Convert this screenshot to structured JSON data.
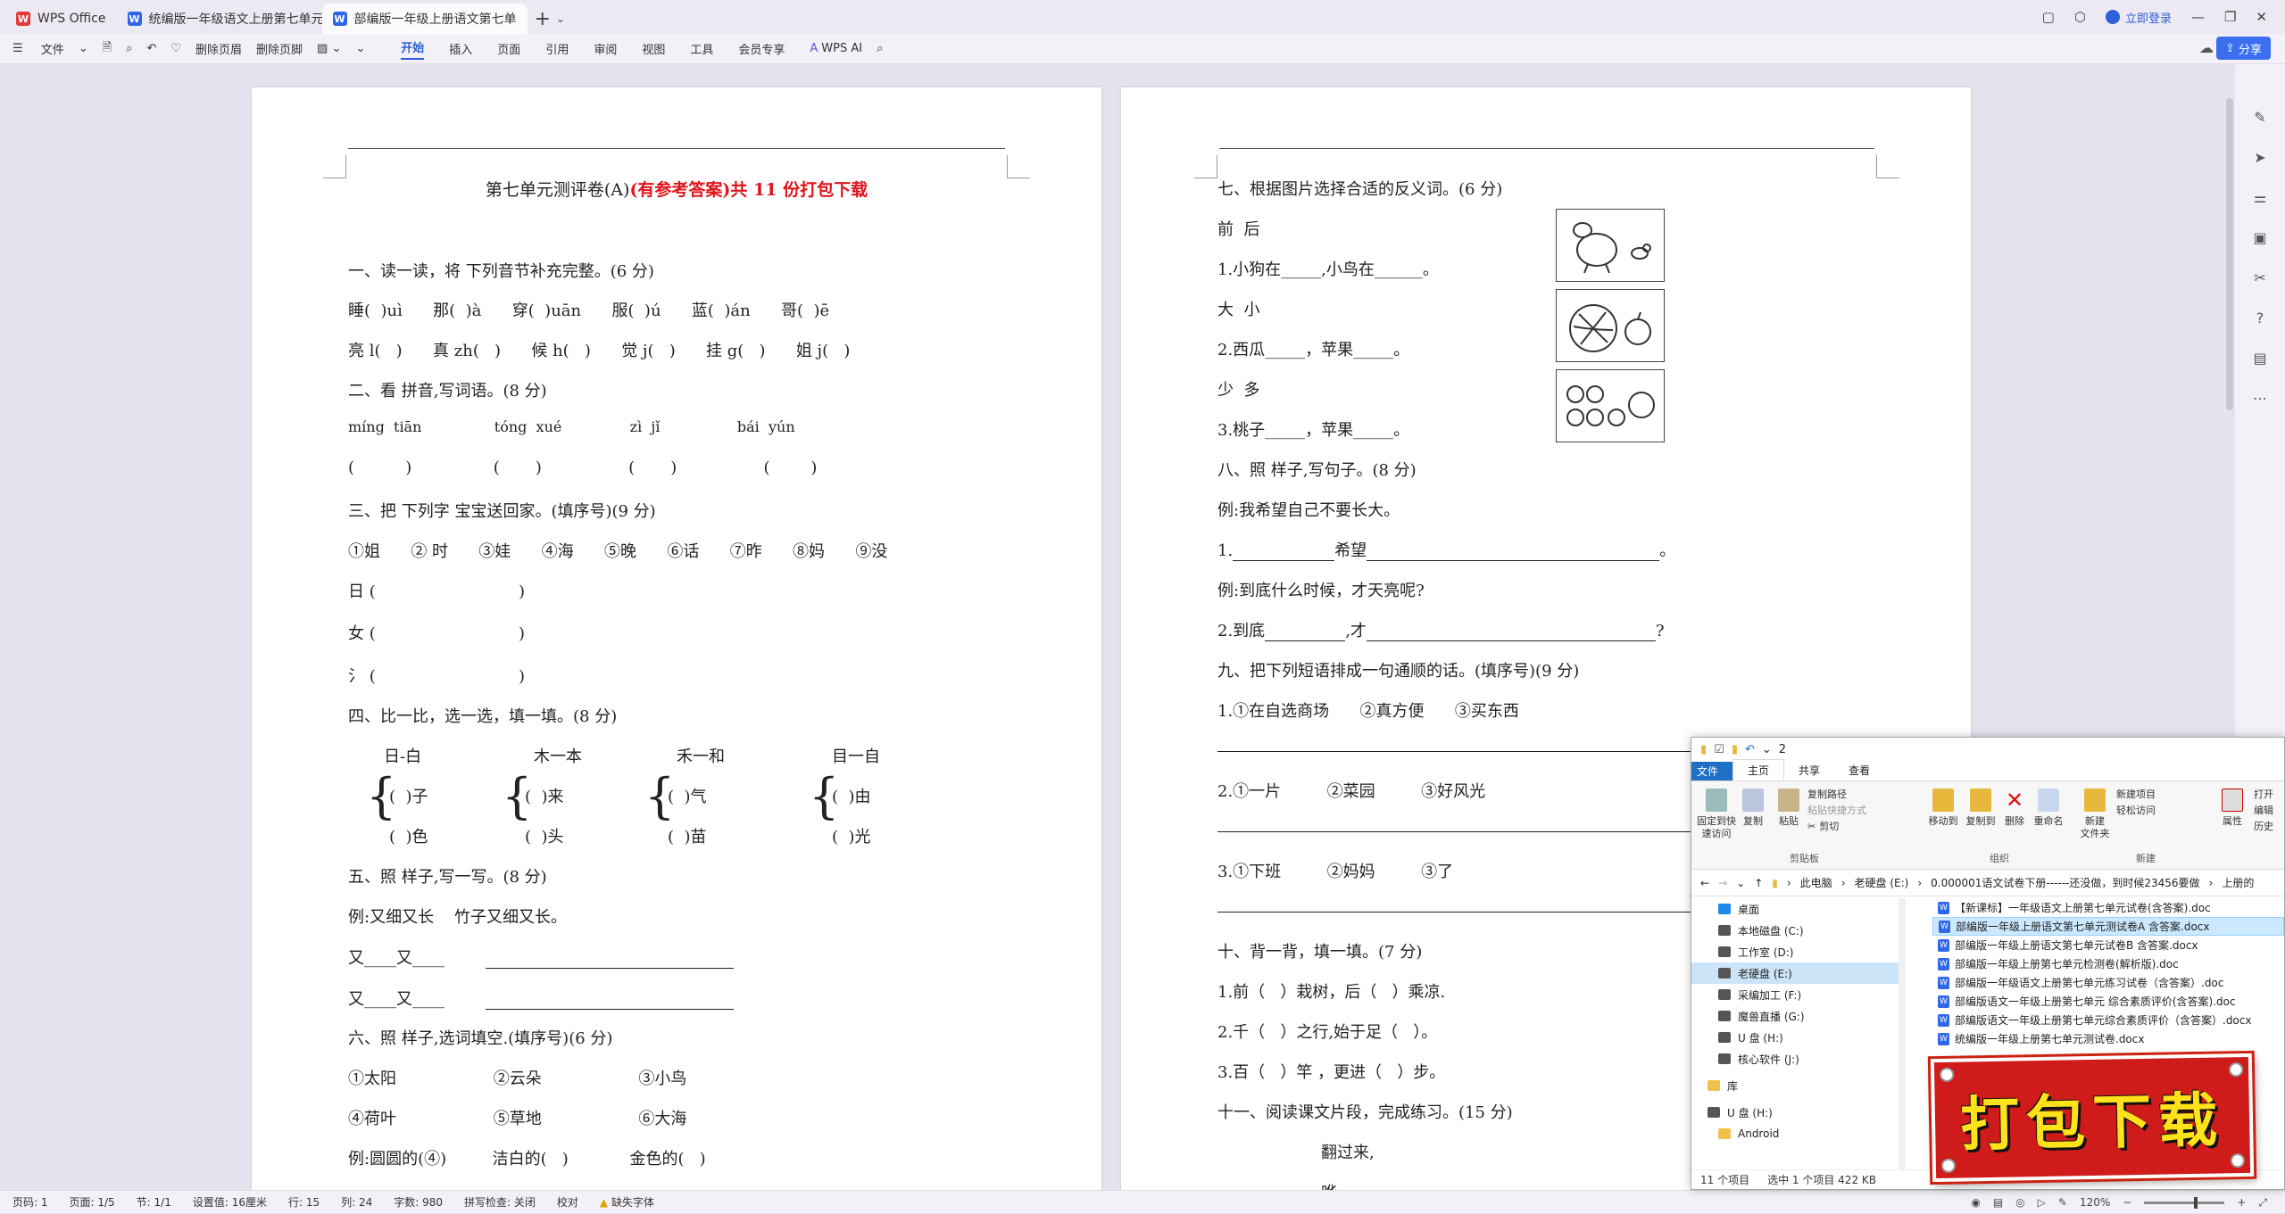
{
  "tabs": [
    {
      "label": "WPS Office",
      "icon": "wps-logo-icon"
    },
    {
      "label": "统编版一年级语文上册第七单元基",
      "icon": "doc-icon"
    },
    {
      "label": "部编版一年级上册语文第七单",
      "icon": "doc-icon"
    }
  ],
  "window": {
    "login": "立即登录",
    "share": "分享"
  },
  "toolbar": {
    "file": "文件",
    "delete_header": "删除页眉",
    "delete_footer": "删除页脚",
    "menus": [
      "开始",
      "插入",
      "页面",
      "引用",
      "审阅",
      "视图",
      "工具",
      "会员专享"
    ],
    "active_menu": "开始",
    "wps_ai": "WPS AI"
  },
  "page1": {
    "title": "第七单元测评卷(A)",
    "title_red": "(有参考答案)共 11 份打包下载",
    "s1": "一、读一读，将 下列音节补充完整。(6 分)",
    "s1_row1": "睡(  )uì      那(  )à      穿(  )uān      服(  )ú      蓝(  )án      哥(  )ē",
    "s1_row2": "亮 l(   )      真 zh(   )      候 h(   )      觉 j(   )      挂 g(   )      姐 j(   )",
    "s2": "二、看 拼音,写词语。(8 分)",
    "s2_pinyin": "míng  tiān                tóng  xué               zì  jǐ                 bái  yún",
    "s2_blanks": "(          )                (       )                 (       )                 (        )",
    "s3": "三、把 下列字 宝宝送回家。(填序号)(9 分)",
    "s3_items": "①姐      ② 时      ③娃      ④海      ⑤晚      ⑥话      ⑦昨      ⑧妈      ⑨没",
    "s3_r1": "日 (                            )",
    "s3_r2": "女 (                            )",
    "s3_r3": "氵 (                            )",
    "s4": "四、比一比，选一选，填一填。(8 分)",
    "s4_pairs": [
      "日-白",
      "木一本",
      "禾一和",
      "目一自"
    ],
    "s4_top": [
      "(  )子",
      "(  )来",
      "(  )气",
      "(  )由"
    ],
    "s4_bottom": [
      "(  )色",
      "(  )头",
      "(  )苗",
      "(  )光"
    ],
    "s5": "五、照 样子,写一写。(8 分)",
    "s5_ex": "例:又细又长    竹子又细又长。",
    "s5_r": "又____又____",
    "s6": "六、照 样子,选词填空.(填序号)(6 分)",
    "s6_r1": "①太阳                   ②云朵                   ③小鸟",
    "s6_r2": "④荷叶                   ⑤草地                   ⑥大海",
    "s6_r3": "例:圆圆的(④)         洁白的(   )            金色的(   )"
  },
  "page2": {
    "s7": "七、根据图片选择合适的反义词。(6 分)",
    "s7_a": "前  后",
    "s7_a_q": "1.小狗在_____,小鸟在______。",
    "s7_b": "大  小",
    "s7_b_q": "2.西瓜_____，苹果_____。",
    "s7_c": "少  多",
    "s7_c_q": "3.桃子_____，苹果_____。",
    "s8": "八、照 样子,写句子。(8 分)",
    "s8_ex": "例:我希望自己不要长大。",
    "s8_q1_pre": "1.",
    "s8_q1_mid": "希望",
    "s8_q1_end": "。",
    "s8_ex2": "例:到底什么时候，才天亮呢?",
    "s8_q2_pre": "2.到底",
    "s8_q2_mid": ",才",
    "s8_q2_end": "?",
    "s9": "九、把下列短语排成一句通顺的话。(填序号)(9 分)",
    "s9_q1": "1.①在自选商场      ②真方便      ③买东西",
    "s9_q2": "2.①一片         ②菜园         ③好风光",
    "s9_q3": "3.①下班         ②妈妈         ③了",
    "s10": "十、背一背，填一填。(7 分)",
    "s10_q1": "1.前（   ）栽树，后（   ）乘凉.",
    "s10_q2": "2.千（   ）之行,始于足（   ）。",
    "s10_q3": "3.百（   ）竿 ，更进（   ）步。",
    "s11": "十一、阅读课文片段，完成练习。(15 分)",
    "s11_t1": "翻过来,",
    "s11_t2": "哗——"
  },
  "statusbar": {
    "page": "页码: 1",
    "pages": "页面: 1/5",
    "section": "节: 1/1",
    "setting": "设置值: 16厘米",
    "row": "行: 15",
    "col": "列: 24",
    "words": "字数: 980",
    "spell": "拼写检查: 关闭",
    "proof": "校对",
    "missing_font": "缺失字体",
    "zoom": "120%"
  },
  "explorer": {
    "title": "2",
    "tabs": [
      "文件",
      "主页",
      "共享",
      "查看"
    ],
    "ribbon": {
      "pin": "固定到快\n速访问",
      "copy": "复制",
      "paste": "粘贴",
      "copy_path": "复制路径",
      "paste_shortcut": "粘贴快捷方式",
      "cut": "剪切",
      "move_to": "移动到",
      "copy_to": "复制到",
      "delete": "删除",
      "rename": "重命名",
      "new_folder": "新建\n文件夹",
      "new_item": "新建项目",
      "easy_access": "轻松访问",
      "properties": "属性",
      "open": "打开",
      "edit": "编辑",
      "history": "历史",
      "group_clipboard": "剪贴板",
      "group_organize": "组织",
      "group_new": "新建"
    },
    "address": [
      "此电脑",
      "老硬盘 (E:)",
      "0.000001语文试卷下册------还没做，到时候23456要做",
      "上册的"
    ],
    "nav": [
      {
        "label": "桌面",
        "icon": "desktop-icon"
      },
      {
        "label": "本地磁盘 (C:)",
        "icon": "drive-icon"
      },
      {
        "label": "工作室 (D:)",
        "icon": "drive-icon"
      },
      {
        "label": "老硬盘 (E:)",
        "icon": "drive-icon"
      },
      {
        "label": "采编加工 (F:)",
        "icon": "drive-icon"
      },
      {
        "label": "魔兽直播 (G:)",
        "icon": "drive-icon"
      },
      {
        "label": "U 盘 (H:)",
        "icon": "drive-icon"
      },
      {
        "label": "核心软件 (J:)",
        "icon": "drive-icon"
      },
      {
        "label": "库",
        "icon": "library-icon"
      },
      {
        "label": "U 盘 (H:)",
        "icon": "drive-icon"
      },
      {
        "label": "Android",
        "icon": "folder-icon"
      }
    ],
    "selected_nav": "老硬盘 (E:)",
    "files": [
      "【新课标】一年级语文上册第七单元试卷(含答案).doc",
      "部编版一年级上册语文第七单元测试卷A   含答案.docx",
      "部编版一年级上册语文第七单元试卷B      含答案.docx",
      "部编版一年级上册第七单元检测卷(解析版).doc",
      "部编版一年级语文上册第七单元练习试卷（含答案）.doc",
      "部编版语文一年级上册第七单元 综合素质评价(含答案).doc",
      "部编版语文一年级上册第七单元综合素质评价（含答案）.docx",
      "统编版一年级上册第七单元测试卷.docx"
    ],
    "selected_file": 1,
    "status_count": "11 个项目",
    "status_sel": "选中 1 个项目  422 KB"
  },
  "promo": {
    "text": "打包下载"
  }
}
